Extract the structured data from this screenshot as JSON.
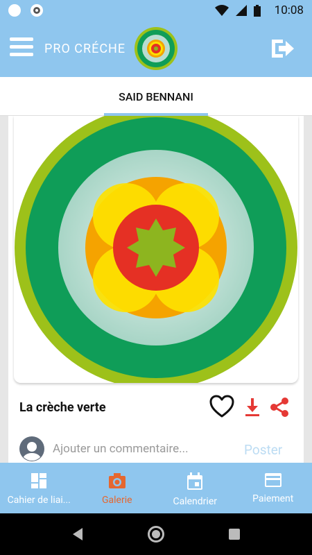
{
  "status_bar": {
    "time": "10:08"
  },
  "app_bar": {
    "title": "PRO CRÉCHE",
    "menu_icon": "hamburger-menu-icon",
    "logout_icon": "logout-icon"
  },
  "tab": {
    "label": "SAID BENNANI"
  },
  "post": {
    "title": "La crèche verte",
    "comment_placeholder": "Ajouter un commentaire...",
    "post_label": "Poster",
    "icons": [
      "heart-icon",
      "download-icon",
      "share-icon"
    ]
  },
  "bottom_nav": {
    "items": [
      {
        "label": "Cahier de liai...",
        "icon": "dashboard-icon",
        "active": false
      },
      {
        "label": "Galerie",
        "icon": "camera-icon",
        "active": true
      },
      {
        "label": "Calendrier",
        "icon": "calendar-icon",
        "active": false
      },
      {
        "label": "Paiement",
        "icon": "credit-card-icon",
        "active": false
      }
    ]
  },
  "colors": {
    "primary": "#8fc6ee",
    "active_nav": "#e5672f",
    "action_red": "#e53935"
  }
}
